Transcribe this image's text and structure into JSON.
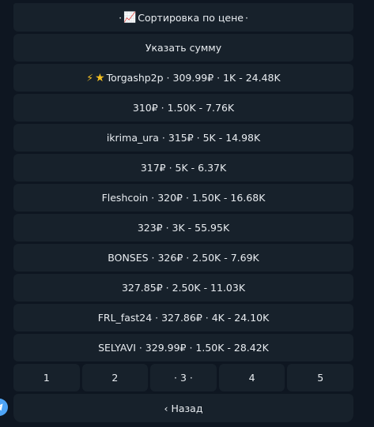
{
  "keyboard": {
    "sort_button": {
      "prefix": "·",
      "icon": "chart-up-icon",
      "label": "Сортировка по цене",
      "suffix": "·"
    },
    "amount_button": "Указать сумму",
    "offers": [
      {
        "icons": [
          "lightning-icon",
          "star-icon"
        ],
        "text": "Torgashp2p · 309.99₽ · 1K - 24.48K"
      },
      {
        "text": "310₽ · 1.50K - 7.76K"
      },
      {
        "text": "ikrima_ura · 315₽ · 5K - 14.98K"
      },
      {
        "text": "317₽ · 5K - 6.37K"
      },
      {
        "text": "Fleshcoin · 320₽ · 1.50K - 16.68K"
      },
      {
        "text": "323₽ · 3K - 55.95K"
      },
      {
        "text": "BONSES · 326₽ · 2.50K - 7.69K"
      },
      {
        "text": "327.85₽ · 2.50K - 11.03K"
      },
      {
        "text": "FRL_fast24 · 327.86₽ · 4K - 24.10K"
      },
      {
        "text": "SELYAVI · 329.99₽ · 1.50K - 28.42K"
      }
    ],
    "pages": [
      "1",
      "2",
      "· 3 ·",
      "4",
      "5"
    ],
    "current_page": "3",
    "back_button": "‹ Назад"
  },
  "colors": {
    "background": "#0e1621",
    "button": "#17212b",
    "text": "#e8ecf0",
    "fab": "#4ea4f6"
  },
  "fab": {
    "icon": "telegram-plane-icon"
  }
}
